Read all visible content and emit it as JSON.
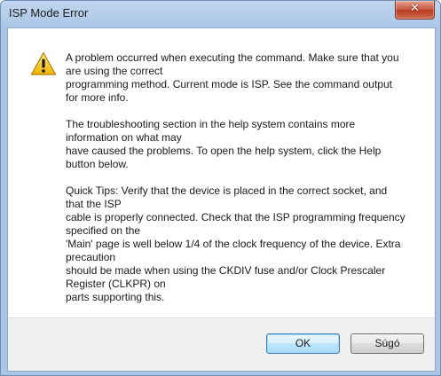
{
  "window": {
    "title": "ISP Mode Error",
    "close_glyph": "✕"
  },
  "message": {
    "paragraph1": [
      "A problem occurred when executing the command. Make sure that you",
      "are using the correct",
      "programming method. Current mode is ISP. See the command output",
      "for more info."
    ],
    "paragraph2": [
      "The troubleshooting section in the help system contains more",
      "information on what may",
      "have caused the problems. To open the help system, click the Help",
      "button below."
    ],
    "paragraph3": [
      "Quick Tips: Verify that the device is placed in the correct socket, and",
      "that the ISP",
      "cable is properly connected. Check that the ISP programming frequency",
      "specified on the",
      "'Main' page is well below 1/4 of the clock frequency of the device. Extra",
      "precaution",
      "should be made when using the CKDIV fuse and/or Clock Prescaler",
      "Register (CLKPR) on",
      "parts supporting this."
    ]
  },
  "buttons": {
    "ok_label": "OK",
    "help_label": "Súgó"
  },
  "icons": {
    "warning": "warning-icon",
    "close": "close-icon"
  },
  "colors": {
    "warning_fill": "#f5c518",
    "close_red": "#c6553f",
    "default_button_border": "#3c7fb1"
  }
}
